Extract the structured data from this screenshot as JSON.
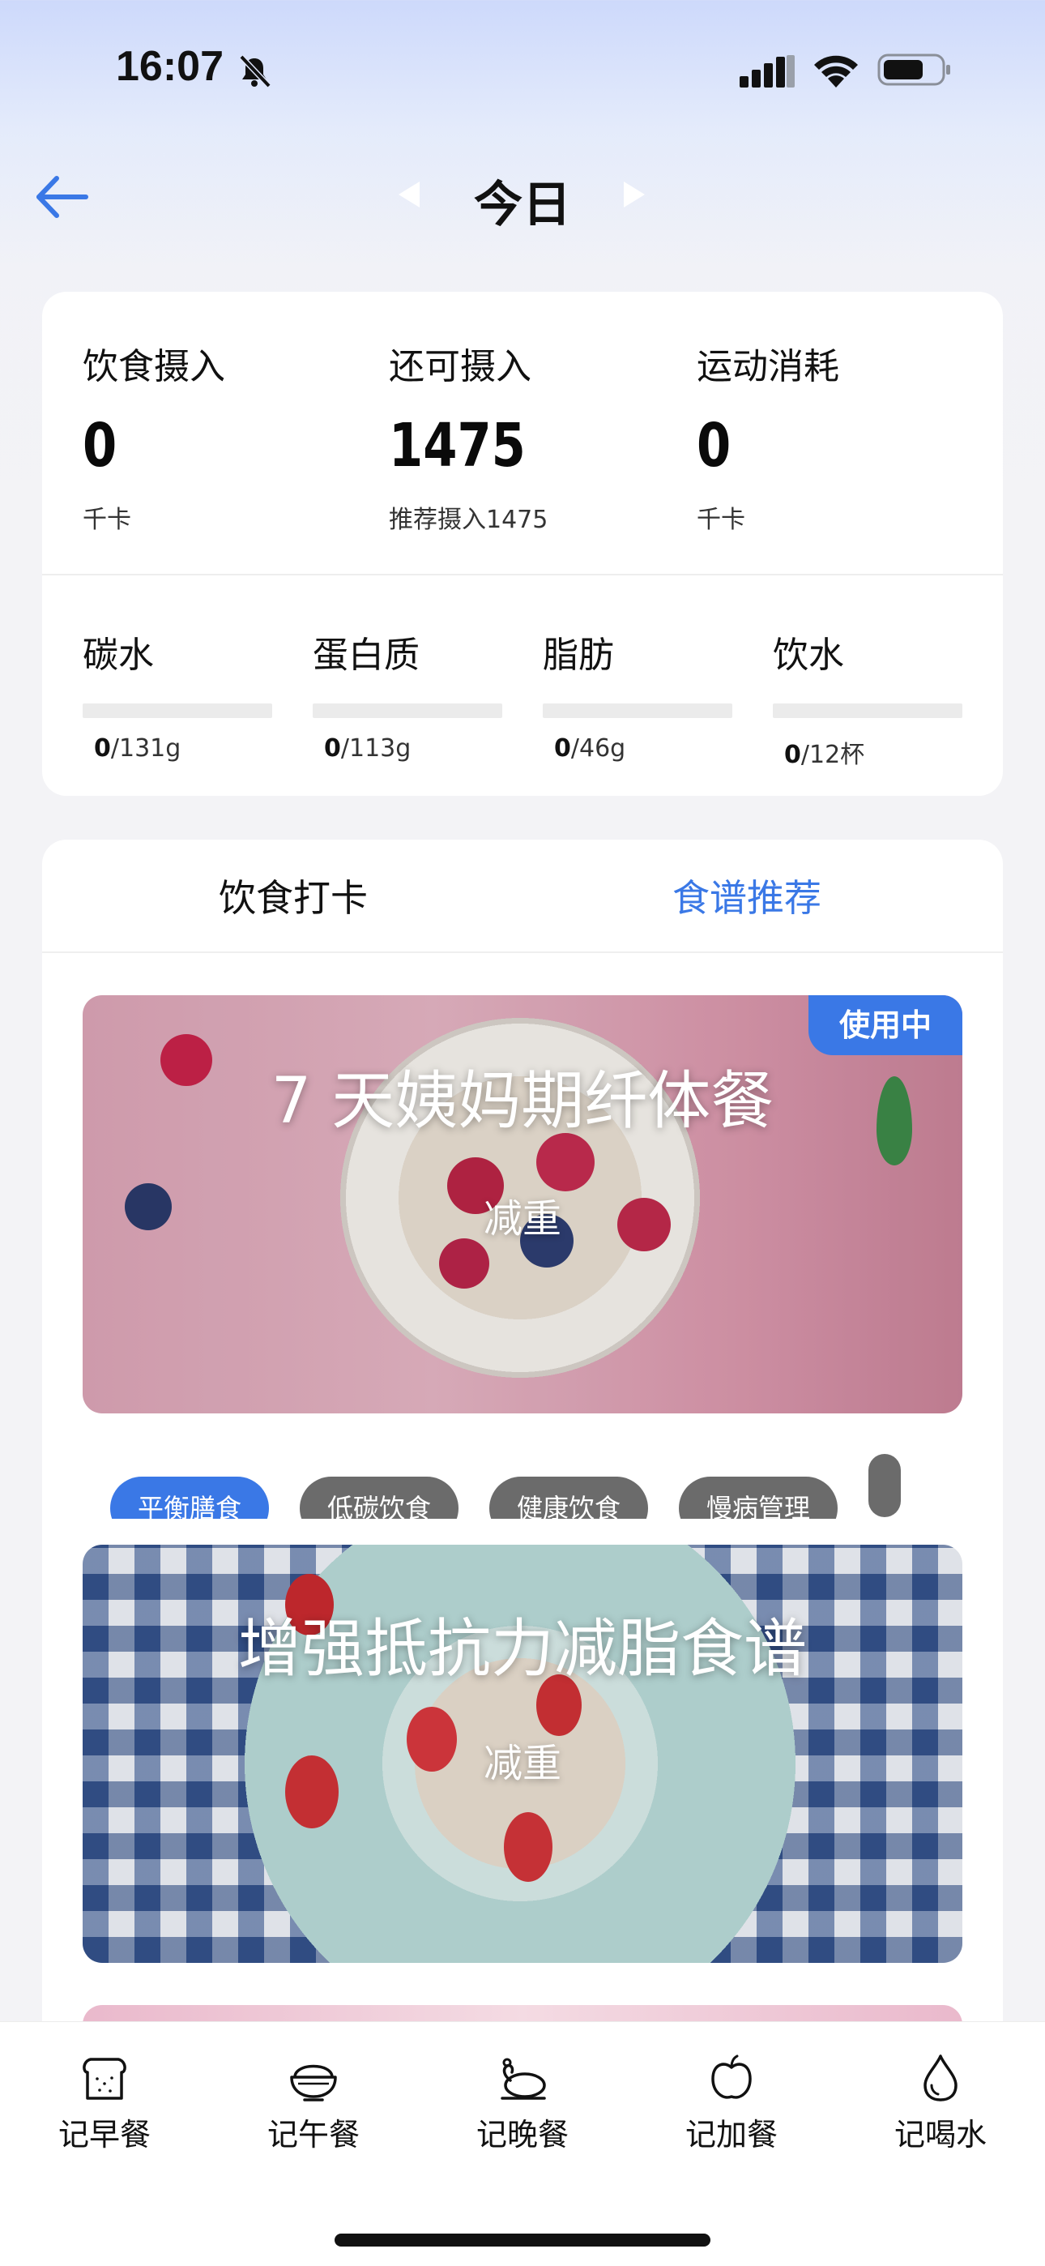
{
  "status_bar": {
    "time": "16:07"
  },
  "nav": {
    "title": "今日"
  },
  "summary": {
    "intake": {
      "label": "饮食摄入",
      "value": "0",
      "unit": "千卡"
    },
    "remaining": {
      "label": "还可摄入",
      "value": "1475",
      "note": "推荐摄入1475"
    },
    "exercise": {
      "label": "运动消耗",
      "value": "0",
      "unit": "千卡"
    },
    "macros": [
      {
        "label": "碳水",
        "current": "0",
        "target": "/131g",
        "progress": 0
      },
      {
        "label": "蛋白质",
        "current": "0",
        "target": "/113g",
        "progress": 0
      },
      {
        "label": "脂肪",
        "current": "0",
        "target": "/46g",
        "progress": 0
      },
      {
        "label": "饮水",
        "current": "0",
        "target": "/12杯",
        "progress": 0
      }
    ]
  },
  "tabs": {
    "diet": "饮食打卡",
    "recipe": "食谱推荐",
    "active": "recipe"
  },
  "banners": [
    {
      "title": "7 天姨妈期纤体餐",
      "subtitle": "减重",
      "badge": "使用中"
    },
    {
      "title": "增强抵抗力减脂食谱",
      "subtitle": "减重"
    }
  ],
  "categories": [
    "平衡膳食",
    "低碳饮食",
    "健康饮食",
    "慢病管理"
  ],
  "active_category": "平衡膳食",
  "bottom_tabs": [
    {
      "label": "记早餐",
      "icon": "bread-icon"
    },
    {
      "label": "记午餐",
      "icon": "rice-bowl-icon"
    },
    {
      "label": "记晚餐",
      "icon": "roast-chicken-icon"
    },
    {
      "label": "记加餐",
      "icon": "apple-icon"
    },
    {
      "label": "记喝水",
      "icon": "water-drop-icon"
    }
  ],
  "colors": {
    "accent": "#3a78e6",
    "chip_inactive": "#6b6b6b"
  }
}
